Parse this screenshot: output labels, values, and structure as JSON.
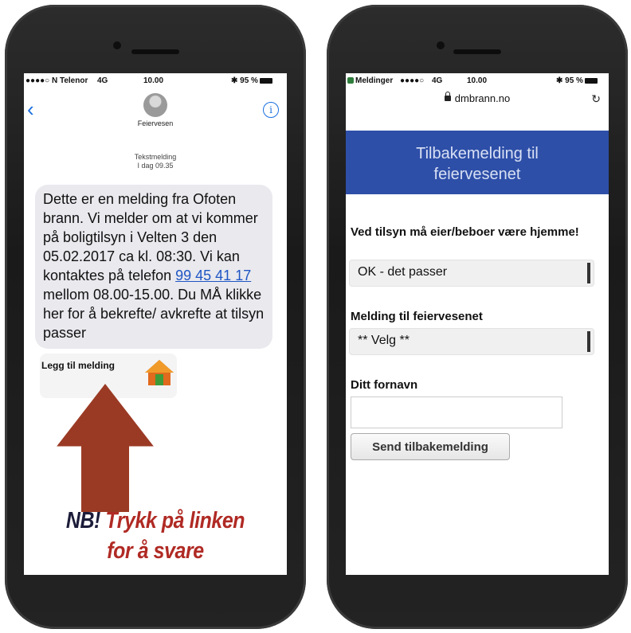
{
  "left_phone": {
    "status": {
      "carrier": "●●●●○ N Telenor",
      "network": "4G",
      "time": "10.00",
      "battery": "✱ 95 %"
    },
    "contact": {
      "name": "Feiervesen"
    },
    "message_meta": {
      "kind": "Tekstmelding",
      "when": "I dag 09.35"
    },
    "message": {
      "part1": "Dette er en melding fra Ofoten brann. Vi melder om at vi kommer på boligtilsyn i Velten 3 den 05.02.2017 ca kl. 08:30. Vi kan kontaktes på telefon ",
      "phone_link": "99 45 41 17",
      "part2": " mellom 08.00-15.00. Du MÅ klikke her for å bekrefte/ avkrefte at tilsyn passer"
    },
    "link_preview": {
      "text": "Legg til melding"
    },
    "icons": {
      "back": "chevron-left-icon",
      "info": "info-icon",
      "avatar": "contact-avatar-icon",
      "home": "house-icon",
      "arrow": "up-arrow-icon"
    },
    "callout": {
      "prefix": "NB!",
      "line1": "Trykk på linken",
      "line2": "for å svare"
    },
    "colors": {
      "callout_red": "#b02a24",
      "callout_dark": "#1c1c3a",
      "link_blue": "#1f56c4",
      "arrow_brown": "#9b3a24"
    }
  },
  "right_phone": {
    "status": {
      "app": "Meldinger",
      "signal": "●●●●○",
      "network": "4G",
      "time": "10.00",
      "battery": "✱ 95 %"
    },
    "url": "dmbrann.no",
    "page": {
      "header_title": "Tilbakemelding til\nfeiervesenet",
      "field1": {
        "label": "Ved tilsyn må eier/beboer være hjemme!",
        "value": "OK - det passer"
      },
      "field2": {
        "label": "Melding til feiervesenet",
        "value": "** Velg **"
      },
      "field3": {
        "label": "Ditt fornavn",
        "value": ""
      },
      "submit_label": "Send tilbakemelding"
    },
    "colors": {
      "header_bg": "#2e4fa8",
      "header_text": "#d8e0f4"
    }
  }
}
